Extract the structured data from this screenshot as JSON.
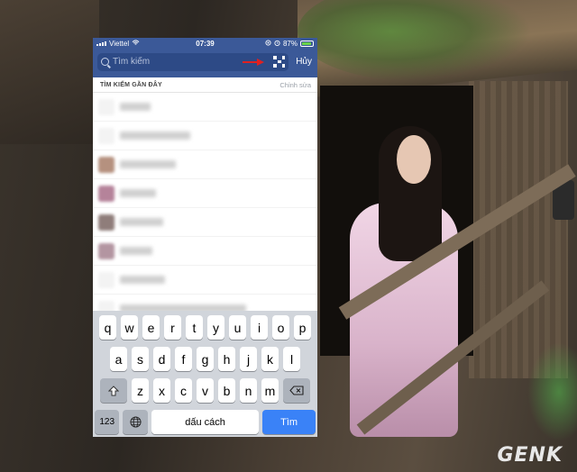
{
  "status_bar": {
    "carrier": "Viettel",
    "time": "07:39",
    "battery_percent": "87%"
  },
  "search": {
    "placeholder": "Tìm kiếm",
    "cancel_label": "Hủy"
  },
  "recent": {
    "header": "TÌM KIẾM GẦN ĐÂY",
    "edit_label": "Chỉnh sửa",
    "item_count_visible": 8
  },
  "keyboard": {
    "row1": [
      "q",
      "w",
      "e",
      "r",
      "t",
      "y",
      "u",
      "i",
      "o",
      "p"
    ],
    "row2": [
      "a",
      "s",
      "d",
      "f",
      "g",
      "h",
      "j",
      "k",
      "l"
    ],
    "row3": [
      "z",
      "x",
      "c",
      "v",
      "b",
      "n",
      "m"
    ],
    "numbers_label": "123",
    "space_label": "dấu cách",
    "go_label": "Tìm"
  },
  "watermark": "GENK",
  "colors": {
    "brand": "#3b5998",
    "go_button": "#3a82f7"
  }
}
